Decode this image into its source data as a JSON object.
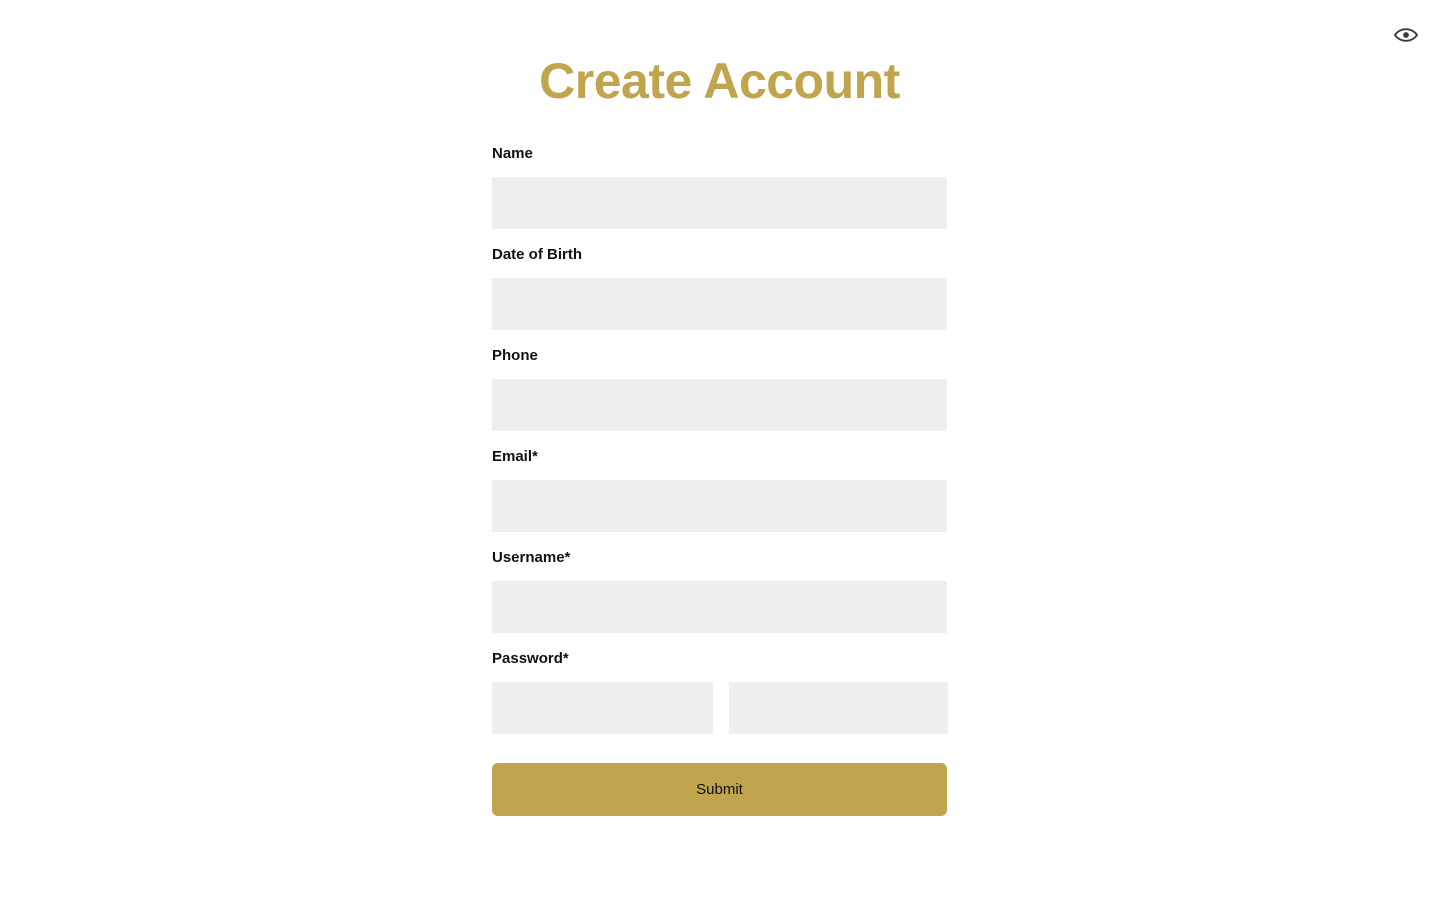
{
  "page": {
    "title": "Create Account",
    "background_color": "#ffffff",
    "accent_color": "#c0a54e",
    "field_background_color": "#eeeeee",
    "label_color": "#111111"
  },
  "topbar": {
    "visibility_toggle": {
      "icon": "eye-icon",
      "color": "#3c3c3c"
    }
  },
  "form": {
    "fields": [
      {
        "name": "name",
        "label": "Name",
        "value": "",
        "placeholder": "",
        "required": false,
        "type": "text"
      },
      {
        "name": "date-of-birth",
        "label": "Date of Birth",
        "value": "",
        "placeholder": "",
        "required": false,
        "type": "text"
      },
      {
        "name": "phone",
        "label": "Phone",
        "value": "",
        "placeholder": "",
        "required": false,
        "type": "text"
      },
      {
        "name": "email",
        "label": "Email*",
        "value": "",
        "placeholder": "",
        "required": true,
        "type": "text"
      },
      {
        "name": "username",
        "label": "Username*",
        "value": "",
        "placeholder": "",
        "required": true,
        "type": "text"
      }
    ],
    "password": {
      "label": "Password*",
      "required": true,
      "first": {
        "value": "",
        "placeholder": ""
      },
      "second": {
        "value": "",
        "placeholder": ""
      }
    },
    "submit": {
      "label": "Submit"
    }
  }
}
